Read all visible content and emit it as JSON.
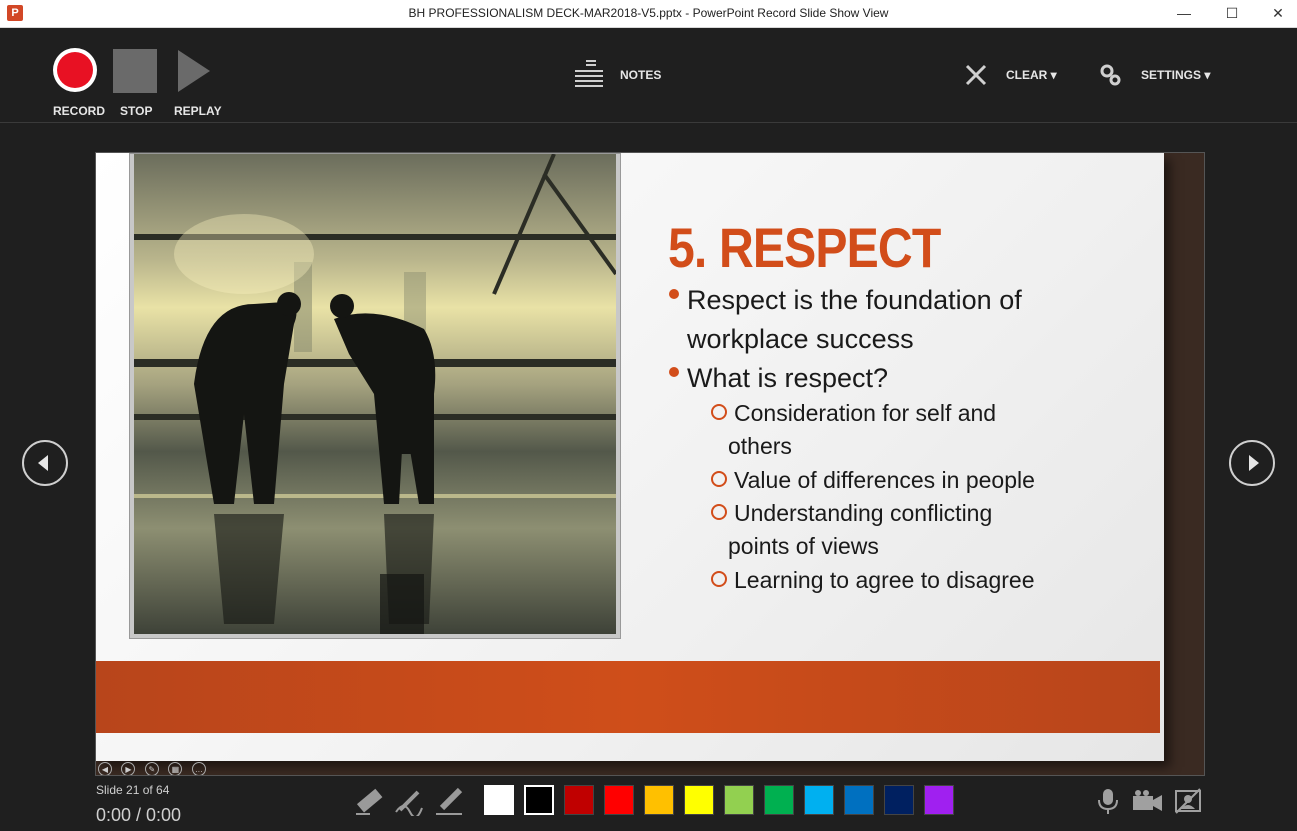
{
  "window": {
    "title": "BH PROFESSIONALISM DECK-MAR2018-V5.pptx - PowerPoint Record Slide Show View",
    "app_icon": "P",
    "minimize": "—",
    "maximize": "☐",
    "close": "✕"
  },
  "toolbar": {
    "record": "RECORD",
    "stop": "STOP",
    "replay": "REPLAY",
    "notes": "NOTES",
    "clear": "CLEAR ▾",
    "settings": "SETTINGS ▾"
  },
  "slide": {
    "title": "5. RESPECT",
    "bullets": [
      "Respect is the foundation of",
      "workplace success",
      "What is respect?"
    ],
    "sub_bullets": [
      "Consideration for self and",
      "others",
      "Value of differences in people",
      "Understanding conflicting",
      "points of views",
      "Learning to agree to disagree"
    ]
  },
  "status": {
    "slide_counter": "Slide 21 of 64",
    "timer": "0:00 / 0:00"
  },
  "ink_colors": [
    "#ffffff",
    "#000000",
    "#c00000",
    "#ff0000",
    "#ffc000",
    "#ffff00",
    "#92d050",
    "#00b050",
    "#00b0f0",
    "#0070c0",
    "#002060",
    "#a020f0"
  ]
}
